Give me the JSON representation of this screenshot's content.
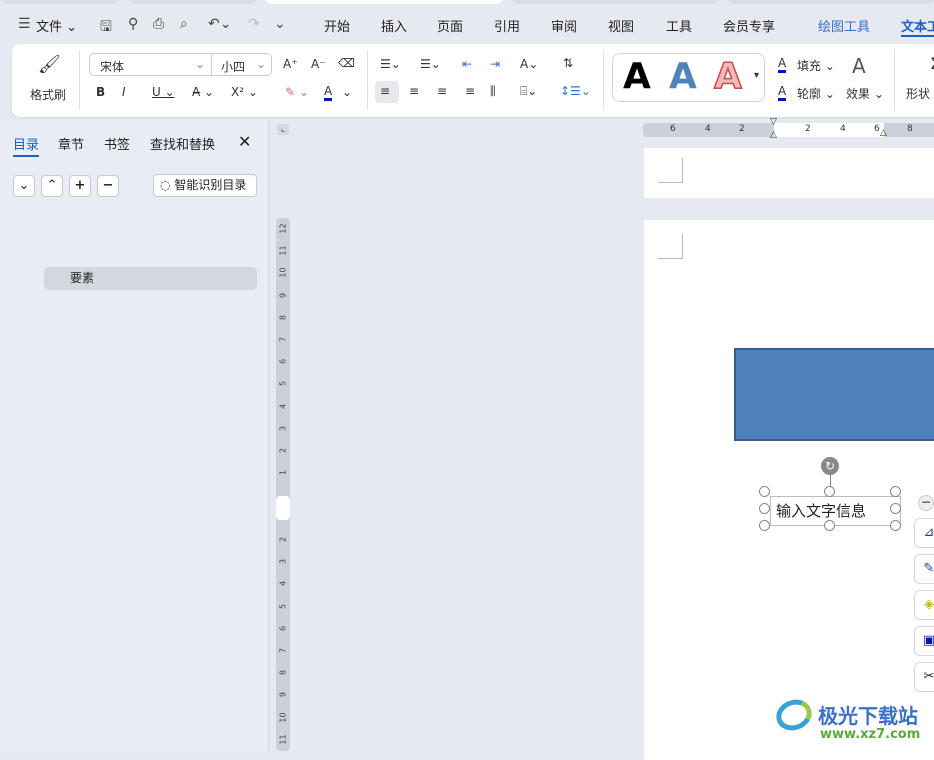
{
  "menu": {
    "file": "文件",
    "tabs": [
      "开始",
      "插入",
      "页面",
      "引用",
      "审阅",
      "视图",
      "工具",
      "会员专享"
    ],
    "drawing_tools": "绘图工具",
    "text_tools": "文本工具"
  },
  "ribbon": {
    "format_painter": "格式刷",
    "font_name": "宋体",
    "font_size": "小四",
    "fill": "填充",
    "outline": "轮廓",
    "effects": "效果",
    "shape": "形状",
    "style_letter": "A"
  },
  "panel": {
    "tabs": [
      "目录",
      "章节",
      "书签",
      "查找和替换"
    ],
    "smart_toc": "智能识别目录",
    "toc_item": "要素"
  },
  "hruler": [
    "6",
    "4",
    "2",
    "2",
    "4",
    "6",
    "8"
  ],
  "vruler_top": [
    "12",
    "11",
    "10",
    "9",
    "8",
    "7",
    "6",
    "5",
    "4",
    "3",
    "2",
    "1"
  ],
  "vruler_bottom": [
    "2",
    "3",
    "4",
    "5",
    "6",
    "7",
    "8",
    "9",
    "10",
    "11"
  ],
  "document": {
    "textbox": "输入文字信息",
    "shape_color": "#4f81bd"
  },
  "watermark": {
    "name": "极光下载站",
    "url": "www.xz7.com"
  }
}
